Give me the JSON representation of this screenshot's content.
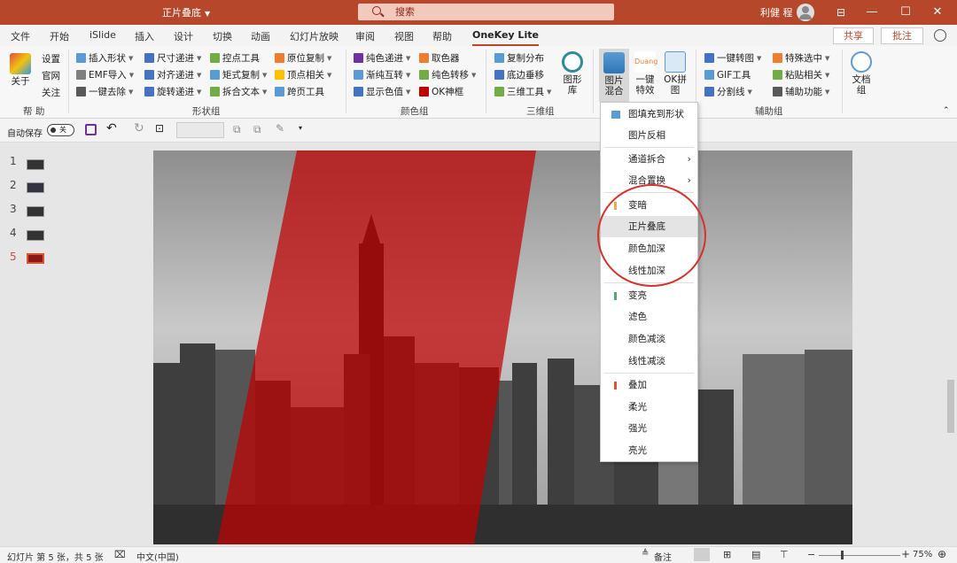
{
  "window": {
    "doc_title": "正片叠底",
    "user_name": "利健 程",
    "minimize": "—",
    "maximize": "☐",
    "close": "✕"
  },
  "search": {
    "placeholder": "搜索"
  },
  "tabs": [
    "文件",
    "开始",
    "iSlide",
    "插入",
    "设计",
    "切换",
    "动画",
    "幻灯片放映",
    "审阅",
    "视图",
    "帮助",
    "OneKey Lite"
  ],
  "active_tab": "OneKey Lite",
  "share_label": "共享",
  "comment_label": "批注",
  "ribbon": {
    "help": {
      "about": "关于",
      "settings": "设置",
      "website": "官网",
      "follow": "关注",
      "group": "帮 助"
    },
    "shape": {
      "items": [
        "插入形状",
        "尺寸递进",
        "控点工具",
        "原位复制",
        "EMF导入",
        "对齐递进",
        "矩式复制",
        "顶点相关",
        "一键去除",
        "旋转递进",
        "拆合文本",
        "跨页工具"
      ],
      "group": "形状组"
    },
    "color": {
      "items": [
        "纯色递进",
        "取色器",
        "渐纯互转",
        "纯色转移",
        "显示色值",
        "OK神框"
      ],
      "group": "颜色组"
    },
    "three_d": {
      "items": [
        "复制分布",
        "底边垂移",
        "三维工具"
      ],
      "shape_lib": "图形库",
      "group": "三维组"
    },
    "image": {
      "blend": "图片混合",
      "effects": "一键特效",
      "ok_merge": "OK拼图"
    },
    "aux": {
      "items": [
        "一键转图",
        "特殊选中",
        "GIF工具",
        "粘贴相关",
        "分割线",
        "辅助功能"
      ],
      "docs": "文档组",
      "group": "辅助组"
    }
  },
  "quick_access": {
    "autosave": "自动保存",
    "toggle": "关"
  },
  "slides": [
    {
      "num": "1",
      "current": false
    },
    {
      "num": "2",
      "current": false
    },
    {
      "num": "3",
      "current": false
    },
    {
      "num": "4",
      "current": false
    },
    {
      "num": "5",
      "current": true
    }
  ],
  "menu": {
    "items": [
      {
        "label": "图填充到形状",
        "submenu": false,
        "marker": ""
      },
      {
        "label": "图片反相",
        "submenu": false,
        "marker": ""
      },
      {
        "label": "通道拆合",
        "submenu": true,
        "marker": ""
      },
      {
        "label": "混合置换",
        "submenu": true,
        "marker": ""
      },
      {
        "label": "变暗",
        "submenu": false,
        "marker": "#e8b04a"
      },
      {
        "label": "正片叠底",
        "submenu": false,
        "marker": "",
        "highlighted": true
      },
      {
        "label": "颜色加深",
        "submenu": false,
        "marker": ""
      },
      {
        "label": "线性加深",
        "submenu": false,
        "marker": ""
      },
      {
        "label": "变亮",
        "submenu": false,
        "marker": "#4caa6e"
      },
      {
        "label": "滤色",
        "submenu": false,
        "marker": ""
      },
      {
        "label": "颜色减淡",
        "submenu": false,
        "marker": ""
      },
      {
        "label": "线性减淡",
        "submenu": false,
        "marker": ""
      },
      {
        "label": "叠加",
        "submenu": false,
        "marker": "#d9542f"
      },
      {
        "label": "柔光",
        "submenu": false,
        "marker": ""
      },
      {
        "label": "强光",
        "submenu": false,
        "marker": ""
      },
      {
        "label": "亮光",
        "submenu": false,
        "marker": ""
      }
    ]
  },
  "status": {
    "slide_info": "幻灯片 第 5 张，共 5 张",
    "language": "中文(中国)",
    "notes": "备注",
    "zoom": "75%"
  },
  "colors": {
    "accent": "#b7472a",
    "red_overlay": "#c00000",
    "ring": "#d9322b"
  }
}
